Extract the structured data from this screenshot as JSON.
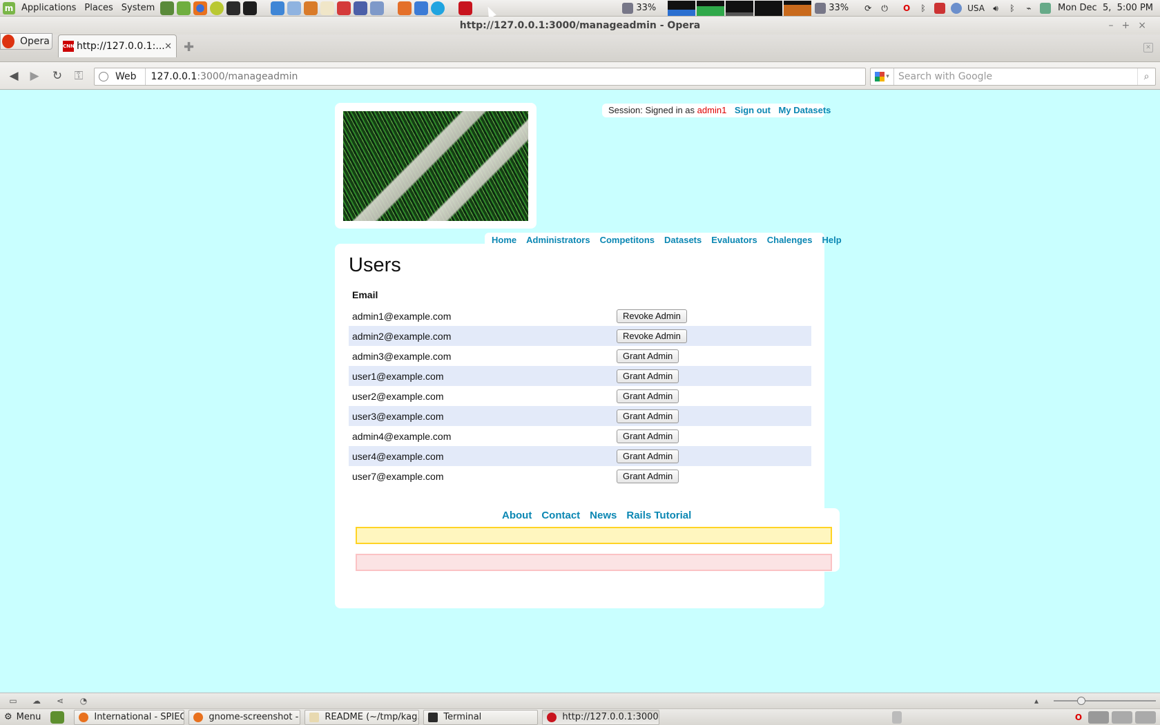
{
  "top_panel": {
    "menus": [
      "Applications",
      "Places",
      "System"
    ],
    "battery_1": "33%",
    "battery_2": "33%",
    "keyboard_layout": "USA",
    "clock": "Mon Dec  5,  5:00 PM"
  },
  "window": {
    "title": "http://127.0.0.1:3000/manageadmin - Opera"
  },
  "browser": {
    "menu_button_label": "Opera",
    "tab_title": "http://127.0.0.1:...",
    "tab_favicon_text": "CNN",
    "address_mode": "Web",
    "address_host": "127.0.0.1",
    "address_path": ":3000/manageadmin",
    "search_placeholder": "Search with Google"
  },
  "session": {
    "prefix": "Session: Signed in as",
    "username": "admin1",
    "sign_out": "Sign out",
    "my_datasets": "My Datasets"
  },
  "nav": {
    "items": [
      "Home",
      "Administrators",
      "Competitons",
      "Datasets",
      "Evaluators",
      "Chalenges",
      "Help"
    ]
  },
  "main": {
    "heading": "Users",
    "column_email": "Email",
    "users": [
      {
        "email": "admin1@example.com",
        "action": "Revoke Admin"
      },
      {
        "email": "admin2@example.com",
        "action": "Revoke Admin"
      },
      {
        "email": "admin3@example.com",
        "action": "Grant Admin"
      },
      {
        "email": "user1@example.com",
        "action": "Grant Admin"
      },
      {
        "email": "user2@example.com",
        "action": "Grant Admin"
      },
      {
        "email": "user3@example.com",
        "action": "Grant Admin"
      },
      {
        "email": "admin4@example.com",
        "action": "Grant Admin"
      },
      {
        "email": "user4@example.com",
        "action": "Grant Admin"
      },
      {
        "email": "user7@example.com",
        "action": "Grant Admin"
      }
    ]
  },
  "footer": {
    "links": [
      "About",
      "Contact",
      "News",
      "Rails Tutorial"
    ]
  },
  "taskbar": {
    "menu_label": "Menu",
    "tasks": [
      "International - SPIEGE...",
      "gnome-screenshot - ...",
      "README (~/tmp/kag...",
      "Terminal",
      "http://127.0.0.1:3000..."
    ]
  },
  "colors": {
    "page_background": "#c9ffff",
    "link": "#0b87b3",
    "username": "#dd0000",
    "row_stripe": "#e3eaf9",
    "notice_bg": "#fff6bf",
    "error_bg": "#fbe3e4"
  }
}
